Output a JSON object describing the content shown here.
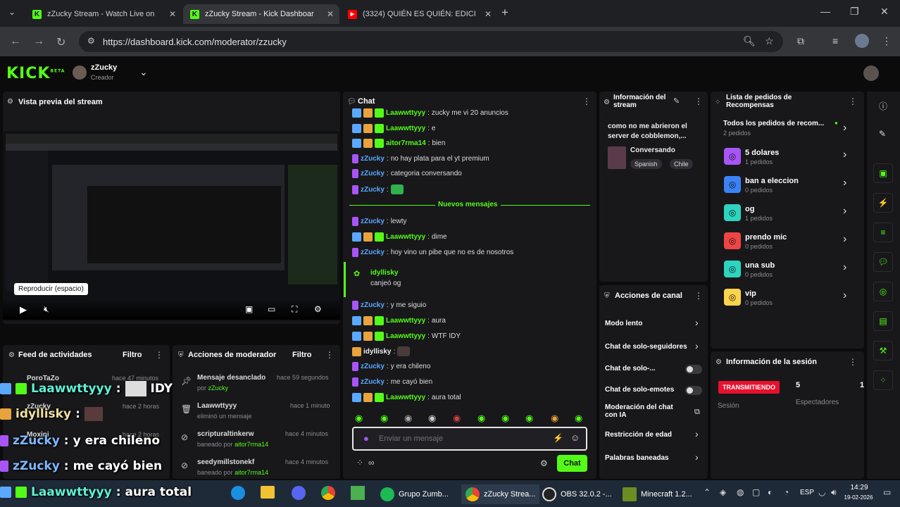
{
  "browser": {
    "tabs": [
      {
        "label": "zZucky Stream - Watch Live on",
        "icon": "kick-favicon"
      },
      {
        "label": "zZucky Stream - Kick Dashboar",
        "icon": "kick-favicon"
      },
      {
        "label": "(3324) QUIÉN ES QUIÉN: EDICI",
        "icon": "youtube-favicon"
      }
    ],
    "url": "https://dashboard.kick.com/moderator/zzucky"
  },
  "header": {
    "logo": "KICK",
    "logo_badge": "BETA",
    "channel_name": "zZucky",
    "channel_role": "Creador"
  },
  "preview": {
    "title": "Vista previa del stream",
    "tooltip": "Reproducir (espacio)"
  },
  "activity": {
    "title": "Feed de actividades",
    "filter": "Filtro",
    "items": [
      {
        "user": "PoroTaZo",
        "time": "hace 47 minutos"
      },
      {
        "user": "zZucky",
        "time": "hace 2 horas"
      },
      {
        "user": "Moxini",
        "time": "hace 2 horas"
      }
    ]
  },
  "modactions": {
    "title": "Acciones de moderador",
    "filter": "Filtro",
    "items": [
      {
        "title": "Mensaje desanclado",
        "sub_prefix": "por",
        "sub_user": "zZucky",
        "time": "hace 59 segundos"
      },
      {
        "title": "Laawwttyyy",
        "sub_prefix": "eliminó un mensaje",
        "sub_user": "",
        "time": "hace 1 minuto"
      },
      {
        "title": "scripturaltinkerw",
        "sub_prefix": "baneado por",
        "sub_user": "aitor7rma14",
        "time": "hace 4 minutos"
      },
      {
        "title": "seedymillstonekf",
        "sub_prefix": "baneado por",
        "sub_user": "aitor7rma14",
        "time": "hace 4 minutos"
      }
    ]
  },
  "chat": {
    "title": "Chat",
    "new_messages": "Nuevos mensajes",
    "messages": [
      {
        "user": "Laawwttyyy",
        "text": "zucky me vi 20 anuncios",
        "color": "green"
      },
      {
        "user": "Laawwttyyy",
        "text": "e",
        "color": "green"
      },
      {
        "user": "aitor7rma14",
        "text": "bien",
        "color": "green"
      },
      {
        "user": "zZucky",
        "text": "no hay plata para el yt premium",
        "color": "blue"
      },
      {
        "user": "zZucky",
        "text": "categoria conversando",
        "color": "blue"
      },
      {
        "user": "zZucky",
        "text": "",
        "color": "blue"
      },
      {
        "user": "zZucky",
        "text": "lewty",
        "color": "blue"
      },
      {
        "user": "Laawwttyyy",
        "text": "dime",
        "color": "green"
      },
      {
        "user": "zZucky",
        "text": "hoy vino un pibe que no es de nosotros",
        "color": "blue"
      },
      {
        "user": "zZucky",
        "text": "y me siguio",
        "color": "blue"
      },
      {
        "user": "Laawwttyyy",
        "text": "aura",
        "color": "green"
      },
      {
        "user": "Laawwttyyy",
        "text": "WTF IDY",
        "color": "green"
      },
      {
        "user": "idyllisky",
        "text": "",
        "color": "white"
      },
      {
        "user": "zZucky",
        "text": "y era chileno",
        "color": "blue"
      },
      {
        "user": "zZucky",
        "text": "me cayó bien",
        "color": "blue"
      },
      {
        "user": "Laawwttyyy",
        "text": "aura total",
        "color": "green"
      }
    ],
    "pinned": {
      "user": "idyllisky",
      "text": "canjeó og"
    },
    "input_placeholder": "Enviar un mensaje",
    "send_label": "Chat"
  },
  "stream_info": {
    "title": "Información del stream",
    "stream_title": "como no me abrieron el server de cobblemon,...",
    "category": "Conversando",
    "tags": [
      "Spanish",
      "Chile"
    ]
  },
  "channel_actions": {
    "title": "Acciones de canal",
    "items": [
      {
        "label": "Modo lento",
        "kind": "chevron"
      },
      {
        "label": "Chat de solo-seguidores",
        "kind": "chevron"
      },
      {
        "label": "Chat de solo-...",
        "kind": "toggle"
      },
      {
        "label": "Chat de solo-emotes",
        "kind": "toggle"
      },
      {
        "label": "Moderación del chat con IA",
        "kind": "external"
      },
      {
        "label": "Restricción de edad",
        "kind": "chevron"
      },
      {
        "label": "Palabras baneadas",
        "kind": "chevron"
      }
    ]
  },
  "rewards": {
    "title": "Lista de pedidos de Recompensas",
    "all": {
      "title": "Todos los pedidos de recom...",
      "sub": "2 pedidos"
    },
    "items": [
      {
        "title": "5 dolares",
        "sub": "1 pedidos",
        "color": "#a855f7"
      },
      {
        "title": "ban a eleccion",
        "sub": "0 pedidos",
        "color": "#3b82f6"
      },
      {
        "title": "og",
        "sub": "1 pedidos",
        "color": "#2dd4bf"
      },
      {
        "title": "prendo mic",
        "sub": "0 pedidos",
        "color": "#ef4444"
      },
      {
        "title": "una sub",
        "sub": "0 pedidos",
        "color": "#2dd4bf"
      },
      {
        "title": "vip",
        "sub": "0 pedidos",
        "color": "#fcd34d"
      }
    ]
  },
  "session": {
    "title": "Información de la sesión",
    "status": "TRANSMITIENDO",
    "status_label": "Sesión",
    "viewers": "5",
    "viewers_label": "Espectadores",
    "extra": "1"
  },
  "overlay": {
    "lines": [
      {
        "user": "Laawwttyyy",
        "text": "IDY"
      },
      {
        "user": "idyllisky",
        "text": ""
      },
      {
        "user": "zZucky",
        "text": "y era chileno"
      },
      {
        "user": "zZucky",
        "text": "me cayó bien"
      },
      {
        "user": "Laawwttyyy",
        "text": "aura total"
      }
    ]
  },
  "taskbar": {
    "apps": [
      "Grupo Zumb...",
      "zZucky Strea...",
      "OBS 32.0.2 -...",
      "Minecraft 1.2..."
    ],
    "language": "ESP",
    "time": "14:29",
    "date": "19-02-2026"
  }
}
